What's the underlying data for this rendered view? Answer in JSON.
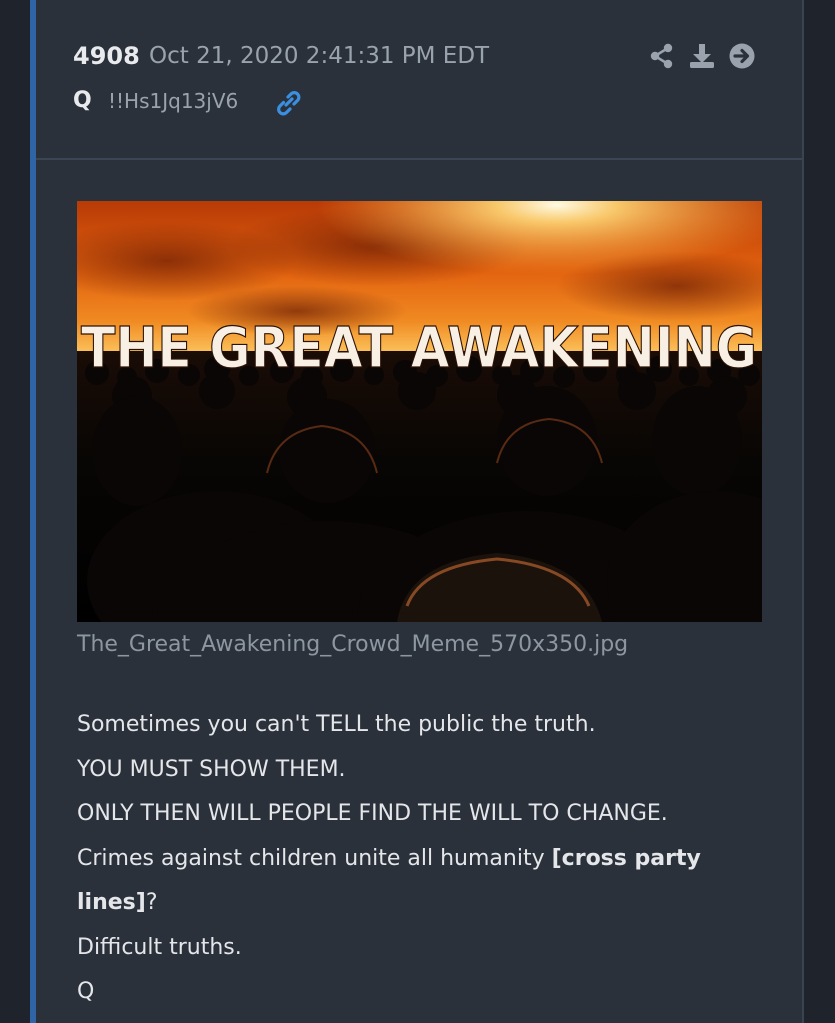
{
  "post": {
    "number": "4908",
    "date": "Oct 21, 2020 2:41:31 PM EDT",
    "author_name": "Q",
    "author_trip": "!!Hs1Jq13jV6"
  },
  "icons": {
    "link": "link-icon",
    "share": "share-icon",
    "download": "download-icon",
    "open": "arrow-right-circle-icon"
  },
  "media": {
    "image_text": "THE GREAT AWAKENING",
    "filename": "The_Great_Awakening_Crowd_Meme_570x350.jpg"
  },
  "body": {
    "line1": "Sometimes you can't TELL the public the truth.",
    "line2": "YOU MUST SHOW THEM.",
    "line3": "ONLY THEN WILL PEOPLE FIND THE WILL TO CHANGE.",
    "line4_text": "Crimes against children unite all humanity ",
    "line4_bold": "[cross party",
    "line5_bold": "lines]",
    "line5_text": "?",
    "line6": "Difficult truths.",
    "line7": "Q"
  },
  "colors": {
    "background": "#1f242c",
    "card": "#2a313b",
    "accent": "#2f64a6",
    "link": "#3b8fe0",
    "icon": "#9aa3ad"
  }
}
